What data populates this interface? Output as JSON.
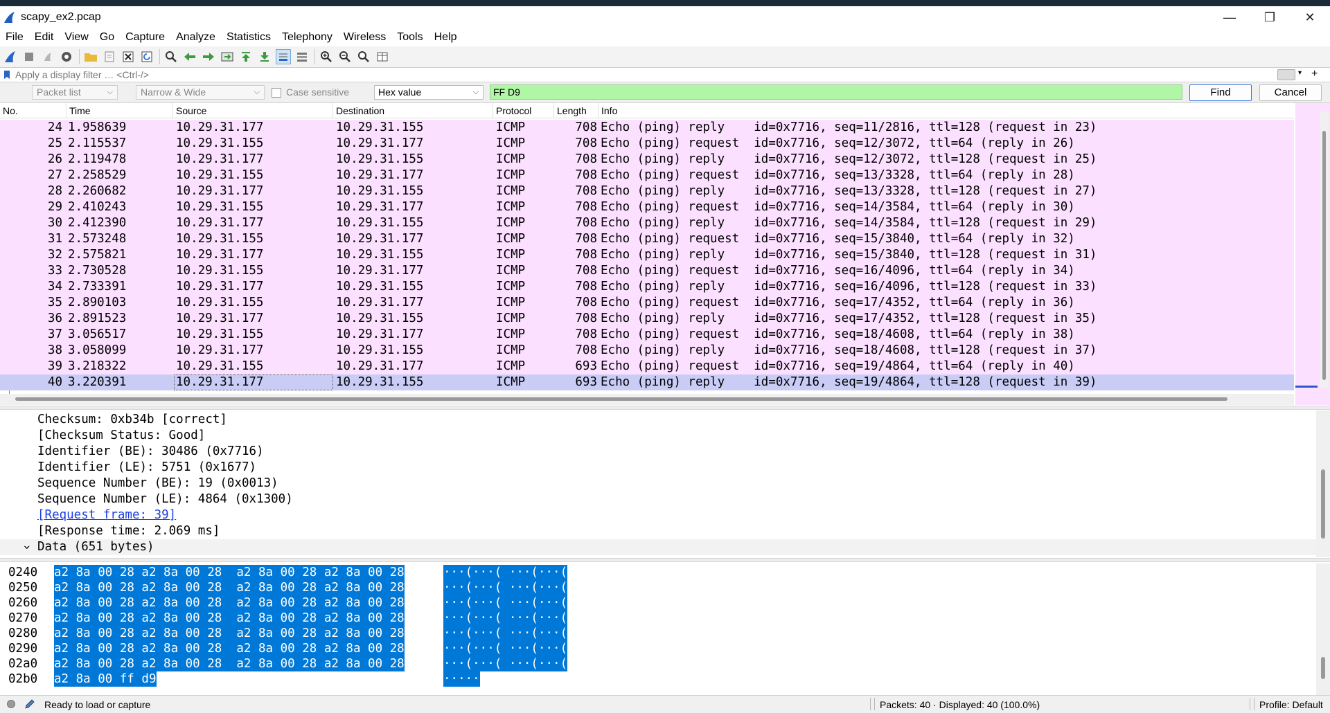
{
  "window": {
    "title": "scapy_ex2.pcap"
  },
  "menu": [
    "File",
    "Edit",
    "View",
    "Go",
    "Capture",
    "Analyze",
    "Statistics",
    "Telephony",
    "Wireless",
    "Tools",
    "Help"
  ],
  "display_filter": {
    "placeholder": "Apply a display filter … <Ctrl-/>"
  },
  "find_bar": {
    "search_in": "Packet list",
    "char_width": "Narrow & Wide",
    "case_sensitive_label": "Case sensitive",
    "search_type": "Hex value",
    "search_value": "FF D9",
    "find_label": "Find",
    "cancel_label": "Cancel"
  },
  "packet_list": {
    "columns": [
      "No.",
      "Time",
      "Source",
      "Destination",
      "Protocol",
      "Length",
      "Info"
    ],
    "rows": [
      {
        "no": "24",
        "time": "1.958639",
        "src": "10.29.31.177",
        "dst": "10.29.31.155",
        "proto": "ICMP",
        "len": "708",
        "info": "Echo (ping) reply    id=0x7716, seq=11/2816, ttl=128 (request in 23)"
      },
      {
        "no": "25",
        "time": "2.115537",
        "src": "10.29.31.155",
        "dst": "10.29.31.177",
        "proto": "ICMP",
        "len": "708",
        "info": "Echo (ping) request  id=0x7716, seq=12/3072, ttl=64 (reply in 26)"
      },
      {
        "no": "26",
        "time": "2.119478",
        "src": "10.29.31.177",
        "dst": "10.29.31.155",
        "proto": "ICMP",
        "len": "708",
        "info": "Echo (ping) reply    id=0x7716, seq=12/3072, ttl=128 (request in 25)"
      },
      {
        "no": "27",
        "time": "2.258529",
        "src": "10.29.31.155",
        "dst": "10.29.31.177",
        "proto": "ICMP",
        "len": "708",
        "info": "Echo (ping) request  id=0x7716, seq=13/3328, ttl=64 (reply in 28)"
      },
      {
        "no": "28",
        "time": "2.260682",
        "src": "10.29.31.177",
        "dst": "10.29.31.155",
        "proto": "ICMP",
        "len": "708",
        "info": "Echo (ping) reply    id=0x7716, seq=13/3328, ttl=128 (request in 27)"
      },
      {
        "no": "29",
        "time": "2.410243",
        "src": "10.29.31.155",
        "dst": "10.29.31.177",
        "proto": "ICMP",
        "len": "708",
        "info": "Echo (ping) request  id=0x7716, seq=14/3584, ttl=64 (reply in 30)"
      },
      {
        "no": "30",
        "time": "2.412390",
        "src": "10.29.31.177",
        "dst": "10.29.31.155",
        "proto": "ICMP",
        "len": "708",
        "info": "Echo (ping) reply    id=0x7716, seq=14/3584, ttl=128 (request in 29)"
      },
      {
        "no": "31",
        "time": "2.573248",
        "src": "10.29.31.155",
        "dst": "10.29.31.177",
        "proto": "ICMP",
        "len": "708",
        "info": "Echo (ping) request  id=0x7716, seq=15/3840, ttl=64 (reply in 32)"
      },
      {
        "no": "32",
        "time": "2.575821",
        "src": "10.29.31.177",
        "dst": "10.29.31.155",
        "proto": "ICMP",
        "len": "708",
        "info": "Echo (ping) reply    id=0x7716, seq=15/3840, ttl=128 (request in 31)"
      },
      {
        "no": "33",
        "time": "2.730528",
        "src": "10.29.31.155",
        "dst": "10.29.31.177",
        "proto": "ICMP",
        "len": "708",
        "info": "Echo (ping) request  id=0x7716, seq=16/4096, ttl=64 (reply in 34)"
      },
      {
        "no": "34",
        "time": "2.733391",
        "src": "10.29.31.177",
        "dst": "10.29.31.155",
        "proto": "ICMP",
        "len": "708",
        "info": "Echo (ping) reply    id=0x7716, seq=16/4096, ttl=128 (request in 33)"
      },
      {
        "no": "35",
        "time": "2.890103",
        "src": "10.29.31.155",
        "dst": "10.29.31.177",
        "proto": "ICMP",
        "len": "708",
        "info": "Echo (ping) request  id=0x7716, seq=17/4352, ttl=64 (reply in 36)"
      },
      {
        "no": "36",
        "time": "2.891523",
        "src": "10.29.31.177",
        "dst": "10.29.31.155",
        "proto": "ICMP",
        "len": "708",
        "info": "Echo (ping) reply    id=0x7716, seq=17/4352, ttl=128 (request in 35)"
      },
      {
        "no": "37",
        "time": "3.056517",
        "src": "10.29.31.155",
        "dst": "10.29.31.177",
        "proto": "ICMP",
        "len": "708",
        "info": "Echo (ping) request  id=0x7716, seq=18/4608, ttl=64 (reply in 38)"
      },
      {
        "no": "38",
        "time": "3.058099",
        "src": "10.29.31.177",
        "dst": "10.29.31.155",
        "proto": "ICMP",
        "len": "708",
        "info": "Echo (ping) reply    id=0x7716, seq=18/4608, ttl=128 (request in 37)"
      },
      {
        "no": "39",
        "time": "3.218322",
        "src": "10.29.31.155",
        "dst": "10.29.31.177",
        "proto": "ICMP",
        "len": "693",
        "info": "Echo (ping) request  id=0x7716, seq=19/4864, ttl=64 (reply in 40)"
      },
      {
        "no": "40",
        "time": "3.220391",
        "src": "10.29.31.177",
        "dst": "10.29.31.155",
        "proto": "ICMP",
        "len": "693",
        "info": "Echo (ping) reply    id=0x7716, seq=19/4864, ttl=128 (request in 39)",
        "selected": true
      }
    ]
  },
  "details": {
    "lines": [
      "Checksum: 0xb34b [correct]",
      "[Checksum Status: Good]",
      "Identifier (BE): 30486 (0x7716)",
      "Identifier (LE): 5751 (0x1677)",
      "Sequence Number (BE): 19 (0x0013)",
      "Sequence Number (LE): 4864 (0x1300)"
    ],
    "link": "[Request frame: 39]",
    "response_time": "[Response time: 2.069 ms]",
    "data_node": "Data (651 bytes)",
    "data_toggle": "›"
  },
  "bytes": {
    "rows": [
      {
        "offset": "0240",
        "hex": "a2 8a 00 28 a2 8a 00 28  a2 8a 00 28 a2 8a 00 28",
        "ascii": "···(···( ···(···("
      },
      {
        "offset": "0250",
        "hex": "a2 8a 00 28 a2 8a 00 28  a2 8a 00 28 a2 8a 00 28",
        "ascii": "···(···( ···(···("
      },
      {
        "offset": "0260",
        "hex": "a2 8a 00 28 a2 8a 00 28  a2 8a 00 28 a2 8a 00 28",
        "ascii": "···(···( ···(···("
      },
      {
        "offset": "0270",
        "hex": "a2 8a 00 28 a2 8a 00 28  a2 8a 00 28 a2 8a 00 28",
        "ascii": "···(···( ···(···("
      },
      {
        "offset": "0280",
        "hex": "a2 8a 00 28 a2 8a 00 28  a2 8a 00 28 a2 8a 00 28",
        "ascii": "···(···( ···(···("
      },
      {
        "offset": "0290",
        "hex": "a2 8a 00 28 a2 8a 00 28  a2 8a 00 28 a2 8a 00 28",
        "ascii": "···(···( ···(···("
      },
      {
        "offset": "02a0",
        "hex": "a2 8a 00 28 a2 8a 00 28  a2 8a 00 28 a2 8a 00 28",
        "ascii": "···(···( ···(···("
      },
      {
        "offset": "02b0",
        "hex": "a2 8a 00 ff d9",
        "ascii": "·····"
      }
    ]
  },
  "status": {
    "ready": "Ready to load or capture",
    "packets": "Packets: 40 · Displayed: 40 (100.0%)",
    "profile": "Profile: Default"
  },
  "colors": {
    "row_bg": "#fce0ff",
    "selected_bg": "#c9cdf6",
    "find_bg": "#aff7a4",
    "byte_highlight": "#0078d7",
    "link": "#1d3fe0"
  }
}
